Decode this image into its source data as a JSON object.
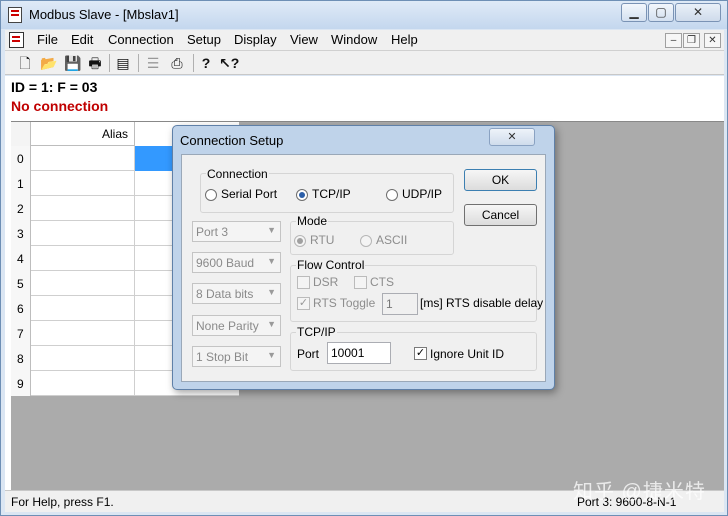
{
  "window": {
    "title": "Modbus Slave - [Mbslav1]"
  },
  "menu": {
    "items": [
      "File",
      "Edit",
      "Connection",
      "Setup",
      "Display",
      "View",
      "Window",
      "Help"
    ]
  },
  "toolbar": {
    "icons": [
      "new-icon",
      "open-icon",
      "save-icon",
      "print-icon",
      "window-icon",
      "cascade-icon",
      "printer-setup-icon",
      "help-icon",
      "context-help-icon"
    ]
  },
  "document": {
    "id_line": "ID = 1: F = 03",
    "status": "No connection",
    "status_color": "#c00000"
  },
  "grid": {
    "alias_header": "Alias",
    "rows": [
      "0",
      "1",
      "2",
      "3",
      "4",
      "5",
      "6",
      "7",
      "8",
      "9"
    ],
    "selected_row": 0,
    "selection_color": "#3399ff"
  },
  "statusbar": {
    "left": "For Help, press F1.",
    "right": "Port 3: 9600-8-N-1"
  },
  "watermark": "知乎 @捷米特",
  "dialog": {
    "title": "Connection Setup",
    "connection_group": "Connection",
    "conn_options": [
      "Serial Port",
      "TCP/IP",
      "UDP/IP"
    ],
    "conn_selected": "TCP/IP",
    "ok": "OK",
    "cancel": "Cancel",
    "port": "Port 3",
    "baud": "9600 Baud",
    "data_bits": "8 Data bits",
    "parity": "None Parity",
    "stop_bits": "1 Stop Bit",
    "mode_group": "Mode",
    "mode_options": [
      "RTU",
      "ASCII"
    ],
    "mode_selected": "RTU",
    "flow_group": "Flow Control",
    "dsr": "DSR",
    "cts": "CTS",
    "rts_toggle": "RTS Toggle",
    "rts_delay_value": "1",
    "rts_delay_label": "[ms] RTS disable delay",
    "tcp_group": "TCP/IP",
    "port_label": "Port",
    "port_value": "10001",
    "ignore_unit_id": "Ignore Unit ID",
    "ignore_unit_id_checked": true
  }
}
